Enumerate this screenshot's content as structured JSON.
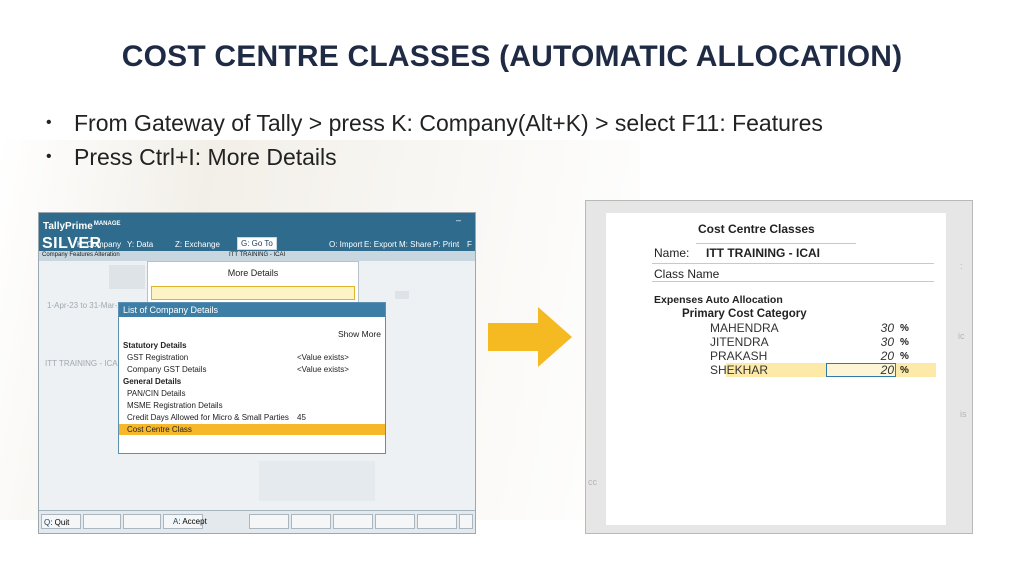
{
  "slide": {
    "title": "COST CENTRE CLASSES (AUTOMATIC ALLOCATION)",
    "bullets": [
      "From Gateway of Tally > press K: Company(Alt+K) > select F11: Features",
      "Press Ctrl+I: More Details"
    ]
  },
  "tally": {
    "brand": "TallyPrime",
    "brand_sub": "MANAGE",
    "edition": "SILVER",
    "menu": [
      "K: Company",
      "Y: Data",
      "Z: Exchange",
      "G: Go To",
      "O: Import",
      "E: Export",
      "M: Share",
      "P: Print",
      "F"
    ],
    "min_icon": "–",
    "subbar_left": "Company Features  Alteration",
    "subbar_center": "ITT TRAINING - ICAI",
    "ghost_date": "1-Apr-23 to 31-Mar-2",
    "ghost_company": "ITT TRAINING - ICA",
    "more_details_title": "More Details",
    "lcd_title": "List of Company Details",
    "show_more": "Show More",
    "rows": [
      {
        "key": "Statutory Details",
        "value": "",
        "group": true,
        "selected": false
      },
      {
        "key": "GST Registration",
        "value": "<Value exists>",
        "group": false,
        "selected": false
      },
      {
        "key": "Company GST Details",
        "value": "<Value exists>",
        "group": false,
        "selected": false
      },
      {
        "key": "General Details",
        "value": "",
        "group": true,
        "selected": false
      },
      {
        "key": "PAN/CIN Details",
        "value": "",
        "group": false,
        "selected": false
      },
      {
        "key": "MSME Registration Details",
        "value": "",
        "group": false,
        "selected": false
      },
      {
        "key": "Credit Days Allowed for Micro & Small Parties",
        "value": "45",
        "group": false,
        "selected": false
      },
      {
        "key": "Cost Centre Class",
        "value": "",
        "group": false,
        "selected": true
      }
    ],
    "fkeys": [
      {
        "hot": "Q",
        "label": ": Quit"
      },
      {
        "hot": "",
        "label": ""
      },
      {
        "hot": "",
        "label": ""
      },
      {
        "hot": "A",
        "label": ": Accept"
      },
      {
        "hot": "",
        "label": ""
      },
      {
        "hot": "",
        "label": ""
      },
      {
        "hot": "",
        "label": ""
      },
      {
        "hot": "",
        "label": ""
      },
      {
        "hot": "",
        "label": ""
      }
    ]
  },
  "arrow": {
    "color": "#f5b921"
  },
  "cost_centre_classes": {
    "title": "Cost Centre Classes",
    "name_label": "Name:",
    "name_value": "ITT TRAINING - ICAI",
    "class_name_label": "Class Name",
    "section": "Expenses Auto Allocation",
    "category": "Primary Cost Category",
    "allocations": [
      {
        "name": "MAHENDRA",
        "percent": "30",
        "sign": "%"
      },
      {
        "name": "JITENDRA",
        "percent": "30",
        "sign": "%"
      },
      {
        "name": "PRAKASH",
        "percent": "20",
        "sign": "%"
      },
      {
        "name": "SHEKHAR",
        "percent": "20",
        "sign": "%"
      }
    ]
  },
  "colors": {
    "title": "#1f2a44",
    "tally_blue": "#2f6b8d",
    "selection": "#f6b72b",
    "arrow": "#f5b921"
  }
}
